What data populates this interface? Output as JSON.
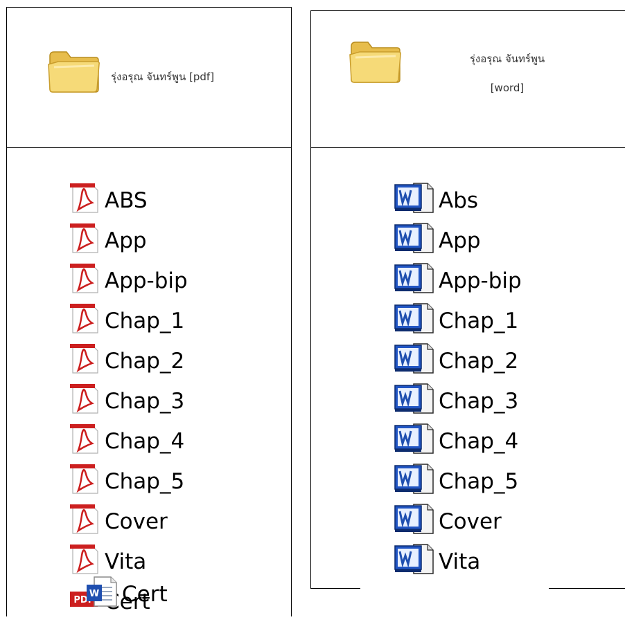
{
  "panels": {
    "pdf": {
      "folder": {
        "label": "รุ่งอรุณ จันทร์พูน [pdf]",
        "icon": "folder-icon"
      },
      "files": [
        {
          "name": "ABS",
          "icon": "acrobat-file-icon"
        },
        {
          "name": "App",
          "icon": "acrobat-file-icon"
        },
        {
          "name": "App-bip",
          "icon": "acrobat-file-icon"
        },
        {
          "name": "Chap_1",
          "icon": "acrobat-file-icon"
        },
        {
          "name": "Chap_2",
          "icon": "acrobat-file-icon"
        },
        {
          "name": "Chap_3",
          "icon": "acrobat-file-icon"
        },
        {
          "name": "Chap_4",
          "icon": "acrobat-file-icon"
        },
        {
          "name": "Chap_5",
          "icon": "acrobat-file-icon"
        },
        {
          "name": "Cover",
          "icon": "acrobat-file-icon"
        },
        {
          "name": "Vita",
          "icon": "acrobat-file-icon"
        },
        {
          "name": "Cert",
          "icon": "pdf-badge-icon",
          "badge": "PDF"
        }
      ]
    },
    "word": {
      "folder": {
        "label_line1": "รุ่งอรุณ จันทร์พูน",
        "label_line2": "[word]",
        "icon": "folder-icon"
      },
      "files": [
        {
          "name": "Abs",
          "icon": "word-doc-icon"
        },
        {
          "name": "App",
          "icon": "word-doc-icon"
        },
        {
          "name": "App-bip",
          "icon": "word-doc-icon"
        },
        {
          "name": "Chap_1",
          "icon": "word-doc-icon"
        },
        {
          "name": "Chap_2",
          "icon": "word-doc-icon"
        },
        {
          "name": "Chap_3",
          "icon": "word-doc-icon"
        },
        {
          "name": "Chap_4",
          "icon": "word-doc-icon"
        },
        {
          "name": "Chap_5",
          "icon": "word-doc-icon"
        },
        {
          "name": "Cover",
          "icon": "word-doc-icon"
        },
        {
          "name": "Vita",
          "icon": "word-doc-icon"
        },
        {
          "name": "Cert",
          "icon": "word-docx-icon",
          "badge": "W"
        }
      ]
    }
  },
  "colors": {
    "pdf_red": "#cc1f1f",
    "word_blue": "#1f4fb0",
    "folder_yellow": "#f3d36b",
    "border": "#000000"
  }
}
